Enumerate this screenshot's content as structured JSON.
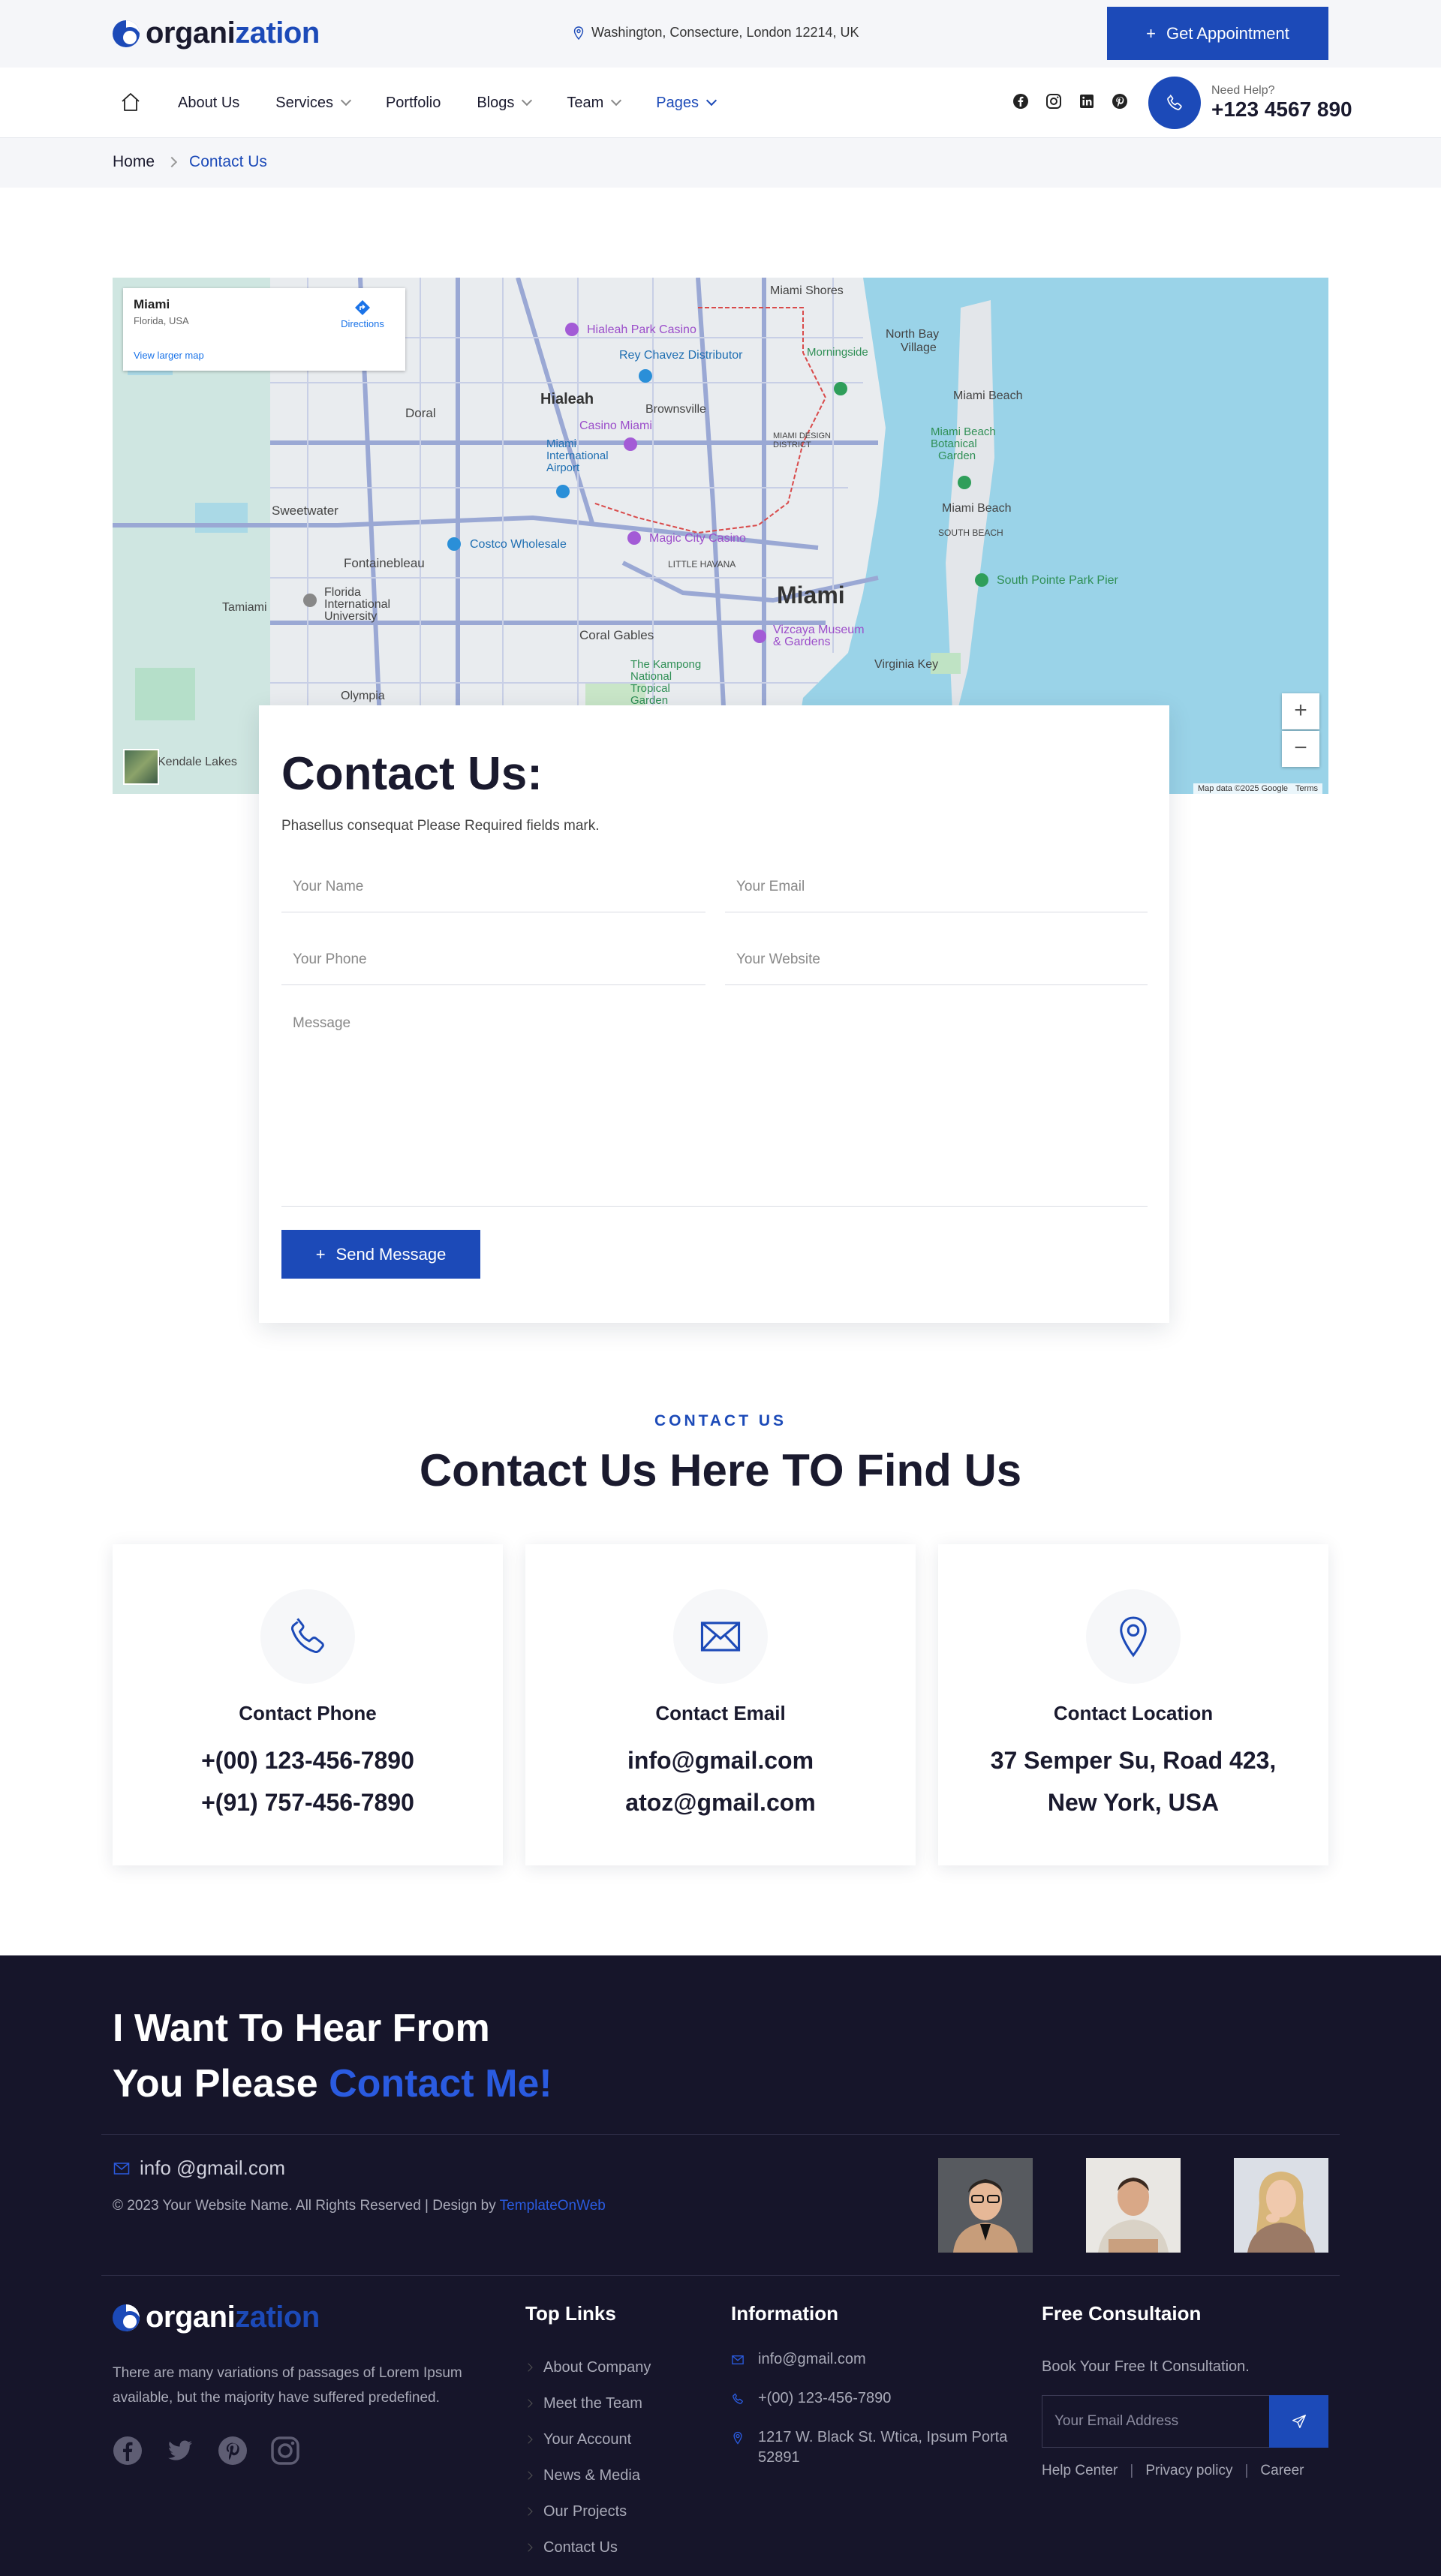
{
  "brand": {
    "logo_part1": "organi",
    "logo_part2": "zation",
    "accent_color": "#1c4ab8",
    "footer_bg": "#16152a"
  },
  "topbar": {
    "address": "Washington, Consecture, London 12214, UK",
    "cta_label": "Get Appointment"
  },
  "nav": {
    "items": [
      {
        "label": "About Us",
        "has_dropdown": false
      },
      {
        "label": "Services",
        "has_dropdown": true
      },
      {
        "label": "Portfolio",
        "has_dropdown": false
      },
      {
        "label": "Blogs",
        "has_dropdown": true
      },
      {
        "label": "Team",
        "has_dropdown": true
      },
      {
        "label": "Pages",
        "has_dropdown": true,
        "active": true
      }
    ],
    "social_icons": [
      "facebook-icon",
      "instagram-icon",
      "linkedin-icon",
      "pinterest-icon"
    ],
    "help_label": "Need Help?",
    "help_phone": "+123 4567 890"
  },
  "breadcrumb": {
    "home": "Home",
    "current": "Contact Us"
  },
  "map": {
    "place_name": "Miami",
    "place_region": "Florida, USA",
    "directions_label": "Directions",
    "larger_map_label": "View larger map",
    "zoom_in": "+",
    "zoom_out": "−",
    "credit": "Map data ©2025 Google",
    "terms": "Terms",
    "labels": [
      "Miami Shores",
      "Hialeah Park Casino",
      "Rey Chavez Distributor",
      "Morningside Park",
      "North Bay Village",
      "Hialeah",
      "Brownsville",
      "Miami Beach",
      "Casino Miami",
      "Doral",
      "Miami International Airport",
      "MIAMI DESIGN DISTRICT",
      "Miami Beach Botanical Garden",
      "Sweetwater",
      "Costco Wholesale",
      "Magic City Casino",
      "Fontainebleau",
      "SOUTH BEACH",
      "South Pointe Park Pier",
      "Florida International University",
      "LITTLE HAVANA",
      "Miami",
      "Tamiami",
      "Coral Gables",
      "Vizcaya Museum & Gardens",
      "Olympia",
      "The Kampong National Tropical Garden",
      "Virginia Key",
      "Kendale Lakes"
    ]
  },
  "form": {
    "title": "Contact Us:",
    "note": "Phasellus consequat Please Required fields mark.",
    "name_placeholder": "Your Name",
    "email_placeholder": "Your Email",
    "phone_placeholder": "Your Phone",
    "website_placeholder": "Your Website",
    "message_placeholder": "Message",
    "submit_label": "Send Message"
  },
  "find_us": {
    "eyebrow": "CONTACT US",
    "title": "Contact Us Here TO Find Us",
    "cards": [
      {
        "icon": "phone-icon",
        "title": "Contact Phone",
        "line1": "+(00) 123-456-7890",
        "line2": "+(91) 757-456-7890"
      },
      {
        "icon": "envelope-icon",
        "title": "Contact Email",
        "line1": "info@gmail.com",
        "line2": "atoz@gmail.com"
      },
      {
        "icon": "location-pin-icon",
        "title": "Contact Location",
        "line1": "37 Semper Su, Road 423,",
        "line2": "New York, USA"
      }
    ]
  },
  "footer": {
    "headline_line1": "I Want To Hear From",
    "headline_line2_start": "You Please ",
    "headline_line2_accent": "Contact Me!",
    "email": "info @gmail.com",
    "copyright_text": "© 2023 Your Website Name. All Rights Reserved | Design by ",
    "copyright_link": "TemplateOnWeb",
    "description": "There are many variations of passages of Lorem Ipsum available, but the majority have suffered predefined.",
    "social_icons": [
      "facebook-icon",
      "twitter-icon",
      "pinterest-icon",
      "instagram-icon"
    ],
    "top_links_title": "Top Links",
    "top_links": [
      "About Company",
      "Meet the Team",
      "Your Account",
      "News & Media",
      "Our Projects",
      "Contact Us"
    ],
    "info_title": "Information",
    "info_email": "info@gmail.com",
    "info_phone": "+(00) 123-456-7890",
    "info_address": "1217 W. Black St. Wtica, Ipsum Porta 52891",
    "consult_title": "Free Consultaion",
    "consult_text": "Book Your Free It Consultation.",
    "subscribe_placeholder": "Your Email Address",
    "bottom_links": [
      "Help Center",
      "Privacy policy",
      "Career"
    ]
  }
}
